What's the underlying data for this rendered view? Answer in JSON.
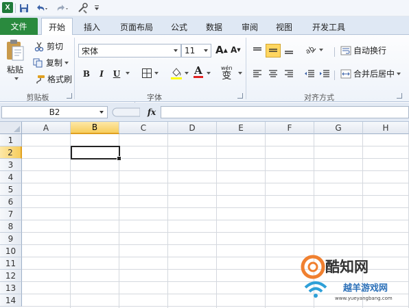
{
  "qat": {
    "excel_logo": "X"
  },
  "tabs": [
    "文件",
    "开始",
    "插入",
    "页面布局",
    "公式",
    "数据",
    "审阅",
    "视图",
    "开发工具"
  ],
  "clipboard": {
    "paste_label": "粘贴",
    "cut_label": "剪切",
    "copy_label": "复制",
    "format_painter_label": "格式刷",
    "group_label": "剪贴板"
  },
  "font": {
    "font_name": "宋体",
    "font_size": "11",
    "grow_label": "A",
    "shrink_label": "A",
    "bold_label": "B",
    "italic_label": "I",
    "underline_label": "U",
    "font_color_label": "A",
    "phonetic_label": "wén",
    "phonetic_char": "变",
    "group_label": "字体"
  },
  "alignment": {
    "wrap_label": "自动换行",
    "merge_label": "合并后居中",
    "group_label": "对齐方式"
  },
  "formula_bar": {
    "name_box": "B2",
    "fx_label": "fx",
    "formula": ""
  },
  "grid": {
    "columns": [
      "A",
      "B",
      "C",
      "D",
      "E",
      "F",
      "G",
      "H"
    ],
    "rows": [
      "1",
      "2",
      "3",
      "4",
      "5",
      "6",
      "7",
      "8",
      "9",
      "10",
      "11",
      "12",
      "13",
      "14"
    ],
    "active_cell": "B2"
  },
  "watermark": {
    "brand": "酷知网",
    "site_name": "越羊游戏网",
    "site_url": "www.yueyangbang.com"
  },
  "colors": {
    "file_tab": "#2a8a3e",
    "selected_header": "#f7cd5c",
    "ribbon_bg": "#eef3fa"
  }
}
